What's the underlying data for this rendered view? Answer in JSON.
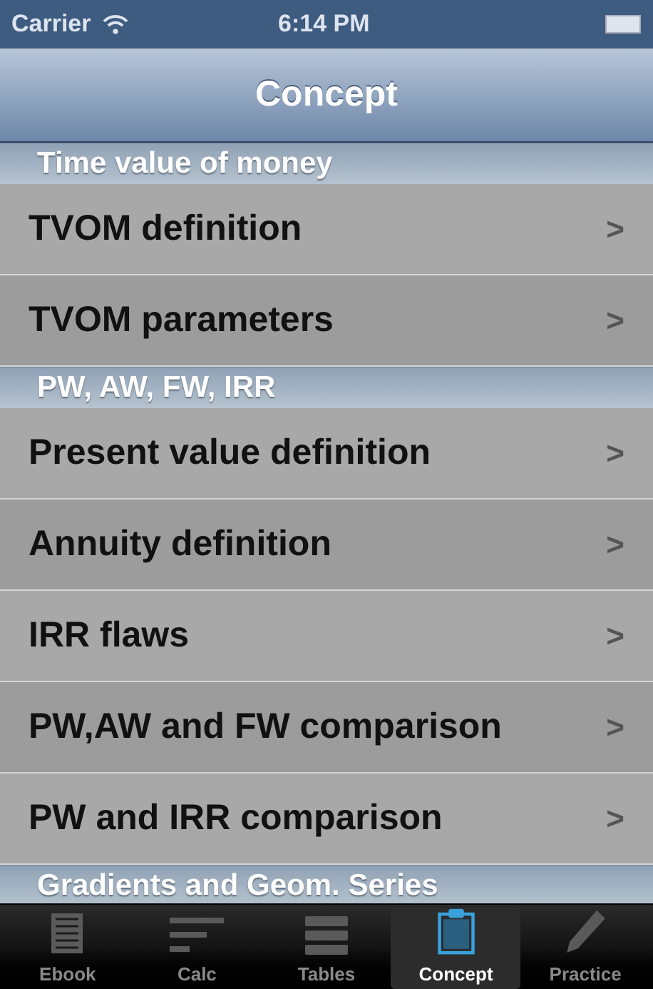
{
  "status_bar": {
    "carrier": "Carrier",
    "time": "6:14 PM"
  },
  "nav_bar": {
    "title": "Concept"
  },
  "sections": [
    {
      "header": "Time value of money",
      "items": [
        {
          "label": "TVOM definition",
          "chevron": ">"
        },
        {
          "label": "TVOM parameters",
          "chevron": ">"
        }
      ]
    },
    {
      "header": "PW, AW, FW, IRR",
      "items": [
        {
          "label": "Present value definition",
          "chevron": ">"
        },
        {
          "label": "Annuity definition",
          "chevron": ">"
        },
        {
          "label": "IRR flaws",
          "chevron": ">"
        },
        {
          "label": "PW,AW and FW comparison",
          "chevron": ">"
        },
        {
          "label": "PW and IRR comparison",
          "chevron": ">"
        }
      ]
    },
    {
      "header": "Gradients and Geom. Series"
    }
  ],
  "tab_bar": [
    {
      "label": "Ebook",
      "kind": "ebook",
      "selected": false
    },
    {
      "label": "Calc",
      "kind": "calc",
      "selected": false
    },
    {
      "label": "Tables",
      "kind": "tables",
      "selected": false
    },
    {
      "label": "Concept",
      "kind": "concept",
      "selected": true
    },
    {
      "label": "Practice",
      "kind": "practice",
      "selected": false
    }
  ]
}
